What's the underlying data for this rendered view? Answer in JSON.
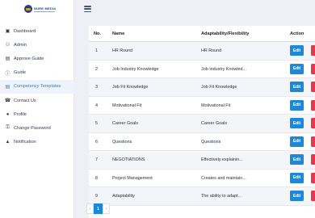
{
  "brand": {
    "logo_text": "NURE MEDIA"
  },
  "sidebar": {
    "items": [
      {
        "label": "Dashboard",
        "icon": "dashboard-icon",
        "glyph": "▣",
        "active": false
      },
      {
        "label": "Admin",
        "icon": "user-group-icon",
        "glyph": "⚇",
        "active": false
      },
      {
        "label": "Approve Guide",
        "icon": "clipboard-icon",
        "glyph": "▤",
        "active": false
      },
      {
        "label": "Guide",
        "icon": "info-icon",
        "glyph": "ⓘ",
        "active": false
      },
      {
        "label": "Competency Templates",
        "icon": "document-icon",
        "glyph": "▤",
        "active": true
      },
      {
        "label": "Contact Us",
        "icon": "phone-icon",
        "glyph": "☎",
        "active": false
      },
      {
        "label": "Profile",
        "icon": "person-icon",
        "glyph": "●",
        "active": false
      },
      {
        "label": "Change Password",
        "icon": "key-icon",
        "glyph": "⚿",
        "active": false
      },
      {
        "label": "Notification",
        "icon": "bell-icon",
        "glyph": "▲",
        "active": false
      }
    ]
  },
  "table": {
    "headers": {
      "no": "No.",
      "name": "Name",
      "adaptability": "Adaptability/Flexibility",
      "action": "Action"
    },
    "edit_label": "Edit",
    "rows": [
      {
        "no": "1",
        "name": "HR Round",
        "adaptability": "HR Round"
      },
      {
        "no": "2",
        "name": "Job Industry Knowledge",
        "adaptability": "Job Industry Knowled..."
      },
      {
        "no": "3",
        "name": "Job Fit Knowledge",
        "adaptability": "Job Fit Knowledge"
      },
      {
        "no": "4",
        "name": "Motivational Fit",
        "adaptability": "Motivational Fit"
      },
      {
        "no": "5",
        "name": "Career Goals",
        "adaptability": "Career Goals"
      },
      {
        "no": "6",
        "name": "Questions",
        "adaptability": "Questions"
      },
      {
        "no": "7",
        "name": "NEGOTIATIONS",
        "adaptability": "Effectively explainin..."
      },
      {
        "no": "8",
        "name": "Project Management",
        "adaptability": "Creates and maintain..."
      },
      {
        "no": "9",
        "name": "Adaptability",
        "adaptability": "The ability to adapt..."
      }
    ]
  },
  "pagination": {
    "prev": "‹",
    "current": "1",
    "next": "›"
  },
  "colors": {
    "accent": "#1e88d8",
    "danger": "#e53945",
    "active_nav": "#2a7fd4"
  }
}
